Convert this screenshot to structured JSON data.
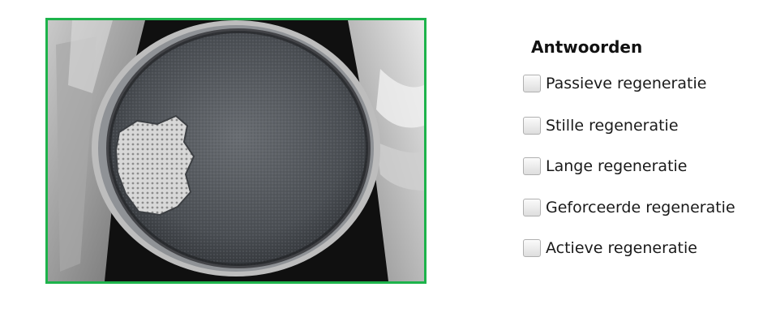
{
  "image": {
    "icon": "dpf-filter-photo"
  },
  "answers": {
    "title": "Antwoorden",
    "options": [
      {
        "label": "Passieve regeneratie",
        "checked": false
      },
      {
        "label": "Stille regeneratie",
        "checked": false
      },
      {
        "label": "Lange regeneratie",
        "checked": false
      },
      {
        "label": "Geforceerde regeneratie",
        "checked": false
      },
      {
        "label": "Actieve regeneratie",
        "checked": false
      }
    ]
  },
  "colors": {
    "frame_border": "#1db34b"
  }
}
